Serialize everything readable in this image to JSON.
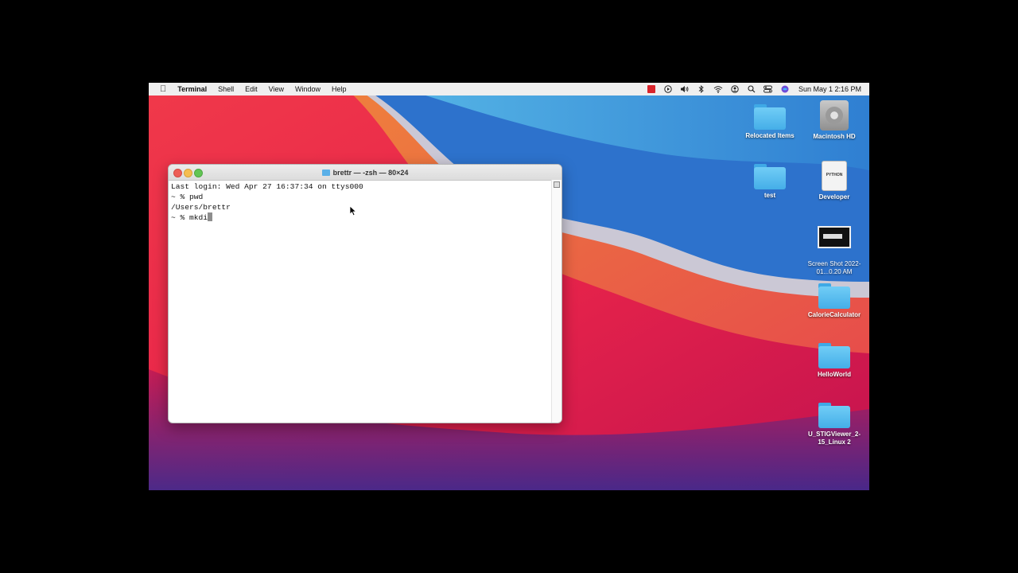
{
  "menubar": {
    "app_name": "Terminal",
    "items": [
      "Shell",
      "Edit",
      "View",
      "Window",
      "Help"
    ],
    "clock": "Sun May 1  2:16 PM",
    "status_icons": [
      "record-icon",
      "play-icon",
      "volume-icon",
      "bluetooth-icon",
      "wifi-icon",
      "user-icon",
      "search-icon",
      "control-center-icon",
      "siri-icon"
    ]
  },
  "terminal": {
    "title": "brettr — -zsh — 80×24",
    "lines": [
      "Last login: Wed Apr 27 16:37:34 on ttys000",
      "~ % pwd",
      "/Users/brettr",
      "~ % mkdi"
    ]
  },
  "desktop": {
    "icons": [
      {
        "label": "Relocated Items",
        "kind": "folder"
      },
      {
        "label": "Macintosh HD",
        "kind": "hard-drive"
      },
      {
        "label": "test",
        "kind": "folder"
      },
      {
        "label": "Developer",
        "kind": "python"
      },
      {
        "label": "Screen Shot 2022-01...0.20 AM",
        "kind": "screenshot"
      },
      {
        "label": "CalorieCalculator",
        "kind": "folder"
      },
      {
        "label": "HelloWorld",
        "kind": "folder"
      },
      {
        "label": "U_STIGViewer_2-15_Linux 2",
        "kind": "folder"
      }
    ],
    "python_badge": "PYTHON"
  },
  "colors": {
    "menubar_bg": "#efefef",
    "close": "#ed5e57",
    "minimize": "#f5bd4f",
    "maximize": "#62c554",
    "folder": "#5ab0e8"
  }
}
